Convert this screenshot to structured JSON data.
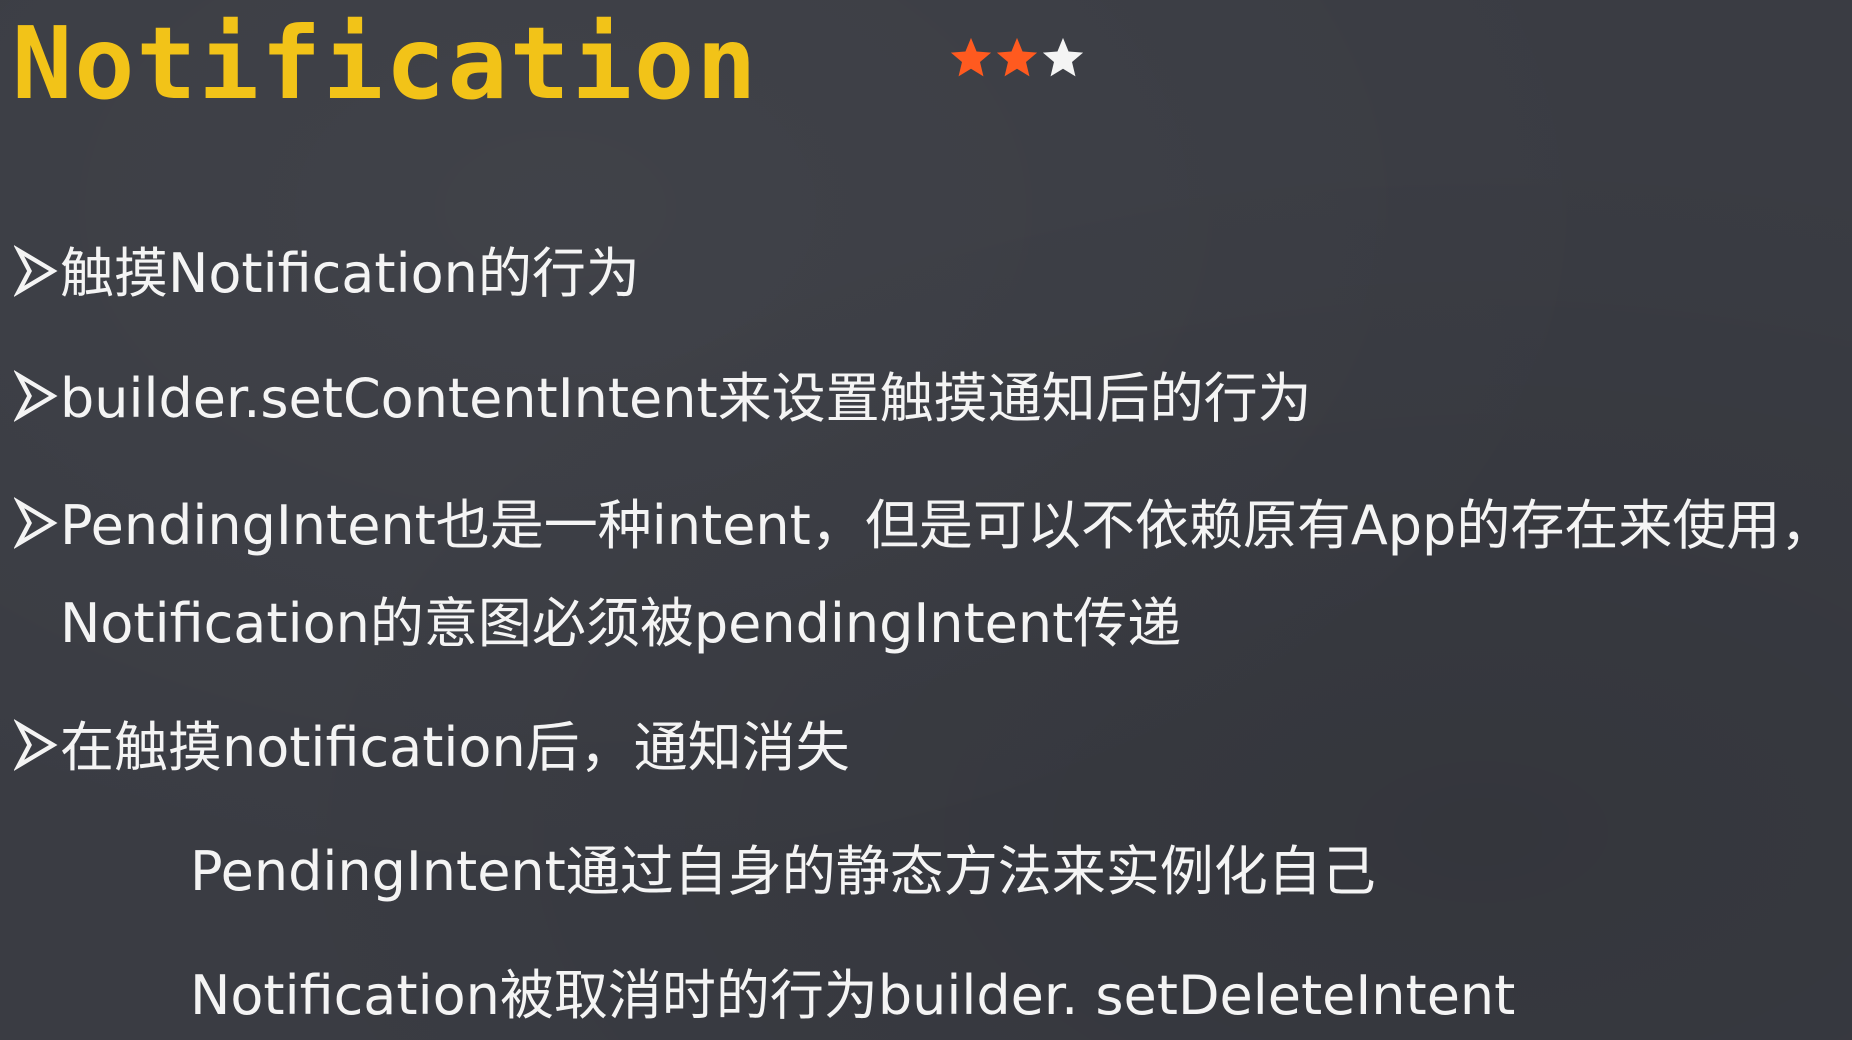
{
  "slide": {
    "title": "Notification",
    "rating": {
      "value": 2,
      "max": 3,
      "filled_color": "#ff5a1f",
      "empty_color": "#f4f4f4"
    },
    "bullet_icon": "arrow-bullet-icon",
    "lines": [
      "触摸Notification的行为",
      "builder.setContentIntent来设置触摸通知后的行为",
      "PendingIntent也是一种intent，但是可以不依赖原有App的存在来使用，",
      "Notification的意图必须被pendingIntent传递",
      "在触摸notification后，通知消失",
      "PendingIntent通过自身的静态方法来实例化自己",
      "Notification被取消时的行为builder. setDeleteIntent"
    ]
  }
}
